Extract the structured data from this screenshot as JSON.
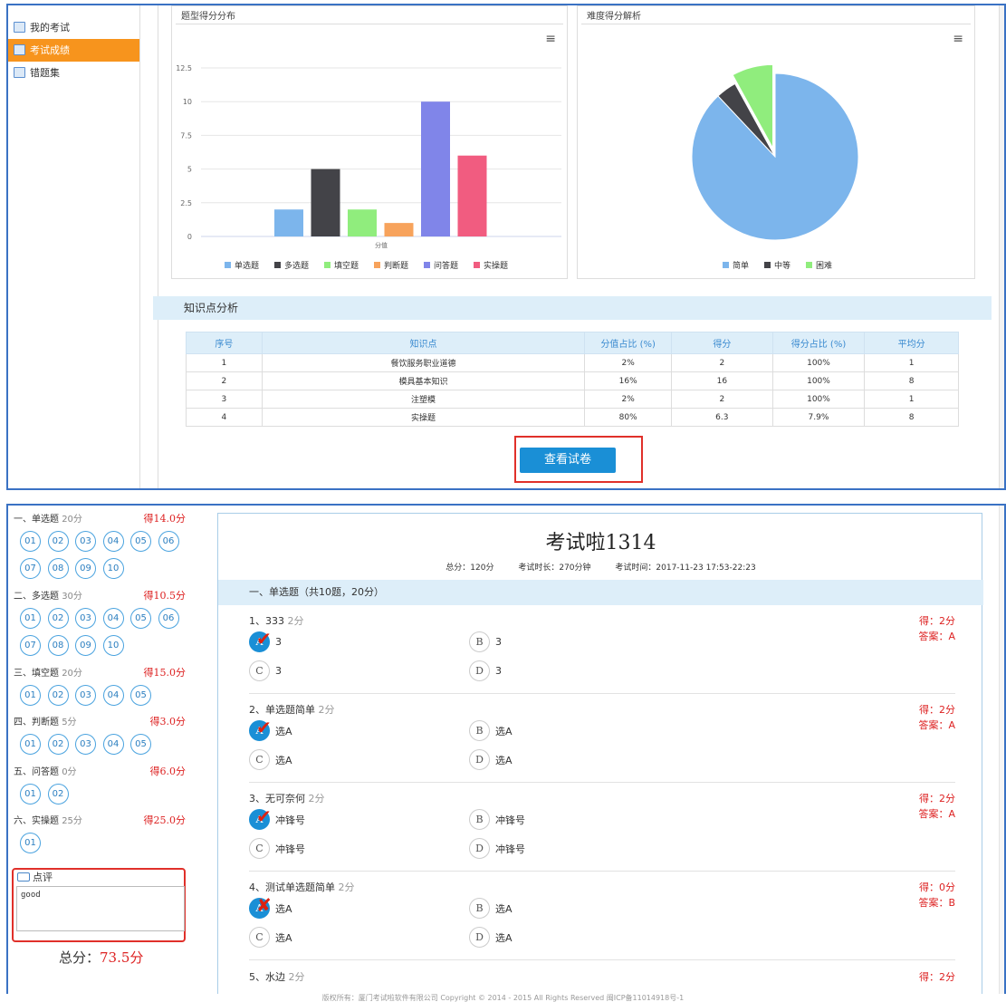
{
  "nav": {
    "items": [
      {
        "label": "我的考试",
        "active": false,
        "icon": "exam-icon"
      },
      {
        "label": "考试成绩",
        "active": true,
        "icon": "score-icon"
      },
      {
        "label": "错题集",
        "active": false,
        "icon": "mistakes-icon"
      }
    ]
  },
  "bar_panel": {
    "title": "题型得分分布",
    "menu_icon": "hamburger-icon"
  },
  "pie_panel": {
    "title": "难度得分解析",
    "menu_icon": "hamburger-icon"
  },
  "chart_data": [
    {
      "type": "bar",
      "title": "",
      "xlabel": "分值",
      "ylabel": "",
      "ylim": [
        0,
        12.5
      ],
      "yticks": [
        "0",
        "2.5",
        "5",
        "7.5",
        "10",
        "12.5"
      ],
      "categories": [
        "单选题",
        "多选题",
        "填空题",
        "判断题",
        "问答题",
        "实操题"
      ],
      "values": [
        2,
        5,
        2,
        1,
        10,
        6
      ],
      "colors": [
        "#7cb5ec",
        "#434348",
        "#90ed7d",
        "#f7a35c",
        "#8085e9",
        "#f15c80"
      ],
      "legend_placement": "bottom"
    },
    {
      "type": "pie",
      "title": "",
      "categories": [
        "简单",
        "中等",
        "困难"
      ],
      "values": [
        88,
        4,
        8
      ],
      "colors": [
        "#7cb5ec",
        "#434348",
        "#90ed7d"
      ],
      "legend_placement": "bottom"
    }
  ],
  "knowledge": {
    "title": "知识点分析",
    "headers": [
      "序号",
      "知识点",
      "分值占比 (%)",
      "得分",
      "得分占比 (%)",
      "平均分"
    ],
    "rows": [
      [
        "1",
        "餐饮服务职业道德",
        "2%",
        "2",
        "100%",
        "1"
      ],
      [
        "2",
        "模具基本知识",
        "16%",
        "16",
        "100%",
        "8"
      ],
      [
        "3",
        "注塑模",
        "2%",
        "2",
        "100%",
        "1"
      ],
      [
        "4",
        "实操题",
        "80%",
        "6.3",
        "7.9%",
        "8"
      ]
    ]
  },
  "view_button": "查看试卷",
  "qnav": {
    "sections": [
      {
        "title": "一、单选题",
        "pts": "20分",
        "score": "得14.0分",
        "nums": [
          "01",
          "02",
          "03",
          "04",
          "05",
          "06",
          "07",
          "08",
          "09",
          "10"
        ]
      },
      {
        "title": "二、多选题",
        "pts": "30分",
        "score": "得10.5分",
        "nums": [
          "01",
          "02",
          "03",
          "04",
          "05",
          "06",
          "07",
          "08",
          "09",
          "10"
        ]
      },
      {
        "title": "三、填空题",
        "pts": "20分",
        "score": "得15.0分",
        "nums": [
          "01",
          "02",
          "03",
          "04",
          "05"
        ]
      },
      {
        "title": "四、判断题",
        "pts": "5分",
        "score": "得3.0分",
        "nums": [
          "01",
          "02",
          "03",
          "04",
          "05"
        ]
      },
      {
        "title": "五、问答题",
        "pts": "0分",
        "score": "得6.0分",
        "nums": [
          "01",
          "02"
        ]
      },
      {
        "title": "六、实操题",
        "pts": "25分",
        "score": "得25.0分",
        "nums": [
          "01"
        ]
      }
    ],
    "comment_label": "点评",
    "comment_icon": "comment-icon",
    "comment_value": "good",
    "total_label": "总分：",
    "total_value": "73.5分"
  },
  "paper": {
    "title": "考试啦1314",
    "meta_total": "总分：120分",
    "meta_duration": "考试时长：270分钟",
    "meta_time": "考试时间：2017-11-23 17:53-22:23",
    "section_title": "一、单选题（共10题，20分）",
    "questions": [
      {
        "title": "1、333",
        "pts": "2分",
        "got": "得：2分",
        "answer": "答案：A",
        "options": [
          "3",
          "3",
          "3",
          "3"
        ],
        "mark": "✔"
      },
      {
        "title": "2、单选题简单",
        "pts": "2分",
        "got": "得：2分",
        "answer": "答案：A",
        "options": [
          "选A",
          "选A",
          "选A",
          "选A"
        ],
        "mark": "✔"
      },
      {
        "title": "3、无可奈何",
        "pts": "2分",
        "got": "得：2分",
        "answer": "答案：A",
        "options": [
          "冲锋号",
          "冲锋号",
          "冲锋号",
          "冲锋号"
        ],
        "mark": "✔"
      },
      {
        "title": "4、测试单选题简单",
        "pts": "2分",
        "got": "得：0分",
        "answer": "答案：B",
        "options": [
          "选A",
          "选A",
          "选A",
          "选A"
        ],
        "mark": "✘"
      },
      {
        "title": "5、水边",
        "pts": "2分",
        "got": "得：2分",
        "answer": "",
        "options": [],
        "mark": ""
      }
    ],
    "letters": [
      "A",
      "B",
      "C",
      "D"
    ]
  },
  "footer": "版权所有：厦门考试啦软件有限公司  Copyright © 2014 - 2015   All Rights Reserved  闽ICP备11014918号-1"
}
